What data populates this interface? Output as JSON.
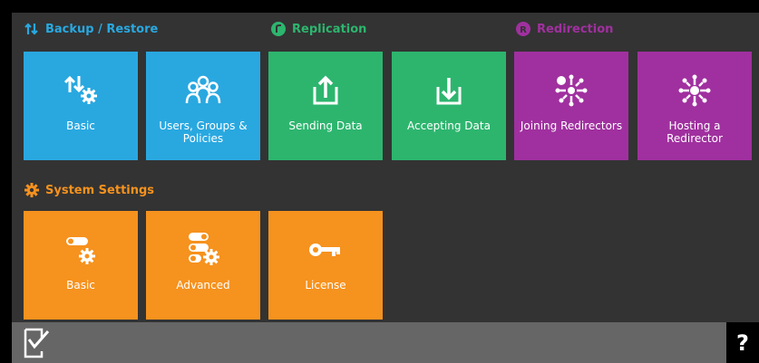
{
  "sections": {
    "backup": {
      "title": "Backup / Restore",
      "color": "#29a8e0"
    },
    "replication": {
      "title": "Replication",
      "color": "#2db56e"
    },
    "redirection": {
      "title": "Redirection",
      "color": "#a0309f"
    },
    "system": {
      "title": "System Settings",
      "color": "#f6921e"
    }
  },
  "tiles": {
    "backup_basic": {
      "label": "Basic",
      "icon": "backup-restore-gear-icon"
    },
    "users_groups": {
      "label": "Users, Groups & Policies",
      "icon": "users-group-icon"
    },
    "sending_data": {
      "label": "Sending Data",
      "icon": "upload-tray-icon"
    },
    "accepting_data": {
      "label": "Accepting Data",
      "icon": "download-tray-icon"
    },
    "joining_redirectors": {
      "label": "Joining Redirectors",
      "icon": "redirector-join-icon"
    },
    "hosting_redirector": {
      "label": "Hosting a Redirector",
      "icon": "redirector-host-icon"
    },
    "system_basic": {
      "label": "Basic",
      "icon": "toggle-gear-icon"
    },
    "system_advanced": {
      "label": "Advanced",
      "icon": "toggles-gears-icon"
    },
    "license": {
      "label": "License",
      "icon": "key-icon"
    }
  },
  "bottom_bar": {
    "help_label": "?",
    "status_icon": "checklist-icon"
  }
}
